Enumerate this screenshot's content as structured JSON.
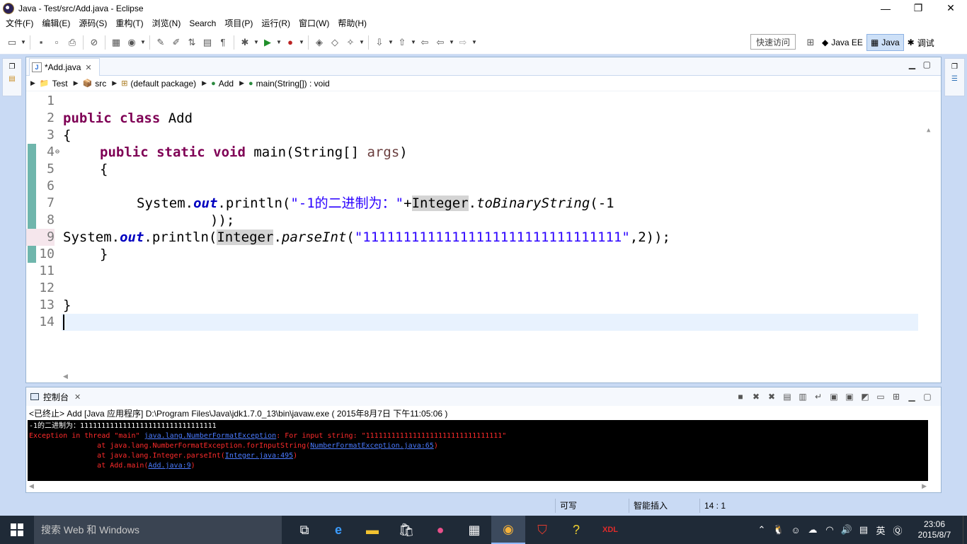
{
  "window": {
    "title": "Java  -  Test/src/Add.java  -  Eclipse",
    "minimize_glyph": "—",
    "restore_glyph": "❐",
    "close_glyph": "✕"
  },
  "menu": [
    "文件(F)",
    "编辑(E)",
    "源码(S)",
    "重构(T)",
    "浏览(N)",
    "Search",
    "项目(P)",
    "运行(R)",
    "窗口(W)",
    "帮助(H)"
  ],
  "toolbar": {
    "quick_access": "快速访问",
    "perspectives": [
      {
        "label": "Java EE",
        "active": false
      },
      {
        "label": "Java",
        "active": true
      },
      {
        "label": "调试",
        "active": false
      }
    ]
  },
  "editor": {
    "tab_label": "*Add.java",
    "breadcrumb": [
      "Test",
      "src",
      "(default package)",
      "Add",
      "main(String[]) : void"
    ],
    "line_numbers": [
      "1",
      "2",
      "3",
      "4",
      "5",
      "6",
      "7",
      "8",
      "9",
      "10",
      "11",
      "12",
      "13",
      "14"
    ],
    "code": {
      "l2_kw": "public class",
      "l2_name": " Add",
      "l3": "{",
      "l4_kw": "public static void",
      "l4_rest": " main(String[] ",
      "l4_arg": "args",
      "l4_end": ")",
      "l5": "{",
      "l7_a": "System.",
      "l7_out": "out",
      "l7_b": ".println(",
      "l7_str": "\"-1的二进制为：\"",
      "l7_plus": "+",
      "l7_int": "Integer",
      "l7_dot": ".",
      "l7_m": "toBinaryString",
      "l7_c": "(-1",
      "l8": "));",
      "l9_a": "System.",
      "l9_out": "out",
      "l9_b": ".println(",
      "l9_int": "Integer",
      "l9_dot": ".",
      "l9_m": "parseInt",
      "l9_c": "(",
      "l9_str": "\"11111111111111111111111111111111\"",
      "l9_d": ",2));",
      "l10": "}",
      "l13": "}"
    }
  },
  "console": {
    "tab_label": "控制台",
    "header": "<已终止> Add [Java 应用程序] D:\\Program Files\\Java\\jdk1.7.0_13\\bin\\javaw.exe ( 2015年8月7日 下午11:05:06 )",
    "stdout_line": "-1的二进制为：11111111111111111111111111111111",
    "err1_a": "Exception in thread \"main\" ",
    "err1_link": "java.lang.NumberFormatException",
    "err1_b": ": For input string: \"11111111111111111111111111111111\"",
    "err2_a": "\tat java.lang.NumberFormatException.forInputString(",
    "err2_link": "NumberFormatException.java:65",
    "err2_b": ")",
    "err3_a": "\tat java.lang.Integer.parseInt(",
    "err3_link": "Integer.java:495",
    "err3_b": ")",
    "err4_a": "\tat Add.main(",
    "err4_link": "Add.java:9",
    "err4_b": ")"
  },
  "status": {
    "writable": "可写",
    "insert_mode": "智能插入",
    "position": "14 : 1"
  },
  "taskbar": {
    "search_placeholder": "搜索 Web 和 Windows",
    "ime": "英",
    "time": "23:06",
    "date": "2015/8/7"
  }
}
